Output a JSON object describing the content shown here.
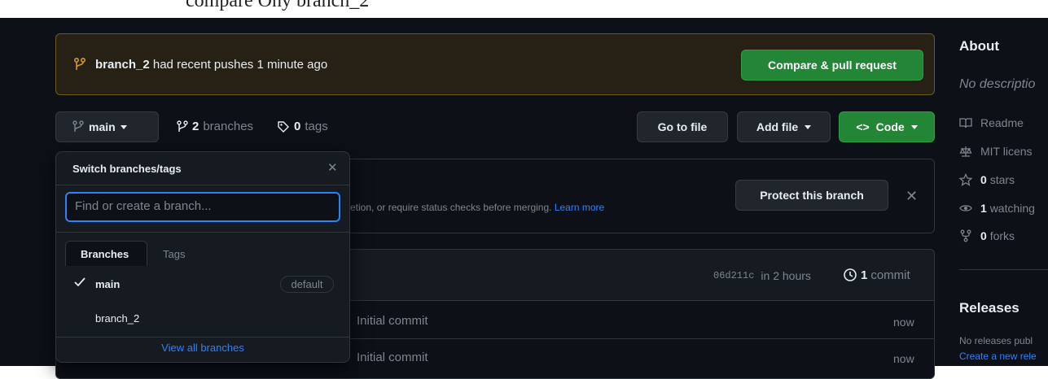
{
  "header": {
    "cut_text": "compare Ony branch_2"
  },
  "banner": {
    "branch": "branch_2",
    "message": "had recent pushes 1 minute ago",
    "compare_label": "Compare & pull request",
    "icon": "git-branch-icon"
  },
  "toolbar": {
    "branch_label": "main",
    "branches_count": "2",
    "branches_label": "branches",
    "tags_count": "0",
    "tags_label": "tags",
    "go_to_file": "Go to file",
    "add_file": "Add file",
    "code_label": "Code"
  },
  "protect": {
    "text": "etion, or require status checks before merging.",
    "learn_more": "Learn more",
    "button": "Protect this branch"
  },
  "commit_bar": {
    "sha": "06d211c",
    "time": "in 2 hours",
    "count": "1",
    "count_label": "commit"
  },
  "files": [
    {
      "message": "Initial commit",
      "time": "now"
    },
    {
      "message": "Initial commit",
      "time": "now"
    }
  ],
  "dropdown": {
    "title": "Switch branches/tags",
    "placeholder": "Find or create a branch...",
    "tabs": [
      "Branches",
      "Tags"
    ],
    "branches": [
      {
        "name": "main",
        "checked": true,
        "badge": "default"
      },
      {
        "name": "branch_2",
        "checked": false,
        "badge": ""
      }
    ],
    "view_all": "View all branches"
  },
  "sidebar": {
    "about_title": "About",
    "description": "No descriptio",
    "items": [
      {
        "icon": "book-icon",
        "count": "",
        "label": "Readme"
      },
      {
        "icon": "law-icon",
        "count": "",
        "label": "MIT licens"
      },
      {
        "icon": "star-icon",
        "count": "0",
        "label": "stars"
      },
      {
        "icon": "eye-icon",
        "count": "1",
        "label": "watching"
      },
      {
        "icon": "fork-icon",
        "count": "0",
        "label": "forks"
      }
    ],
    "releases_title": "Releases",
    "releases_text": "No releases publ",
    "releases_link": "Create a new rele"
  },
  "colors": {
    "accent_blue": "#2f81f7",
    "green": "#238636",
    "background": "#0d1117",
    "banner_bg": "#272115",
    "banner_border": "#6e5b1e"
  }
}
